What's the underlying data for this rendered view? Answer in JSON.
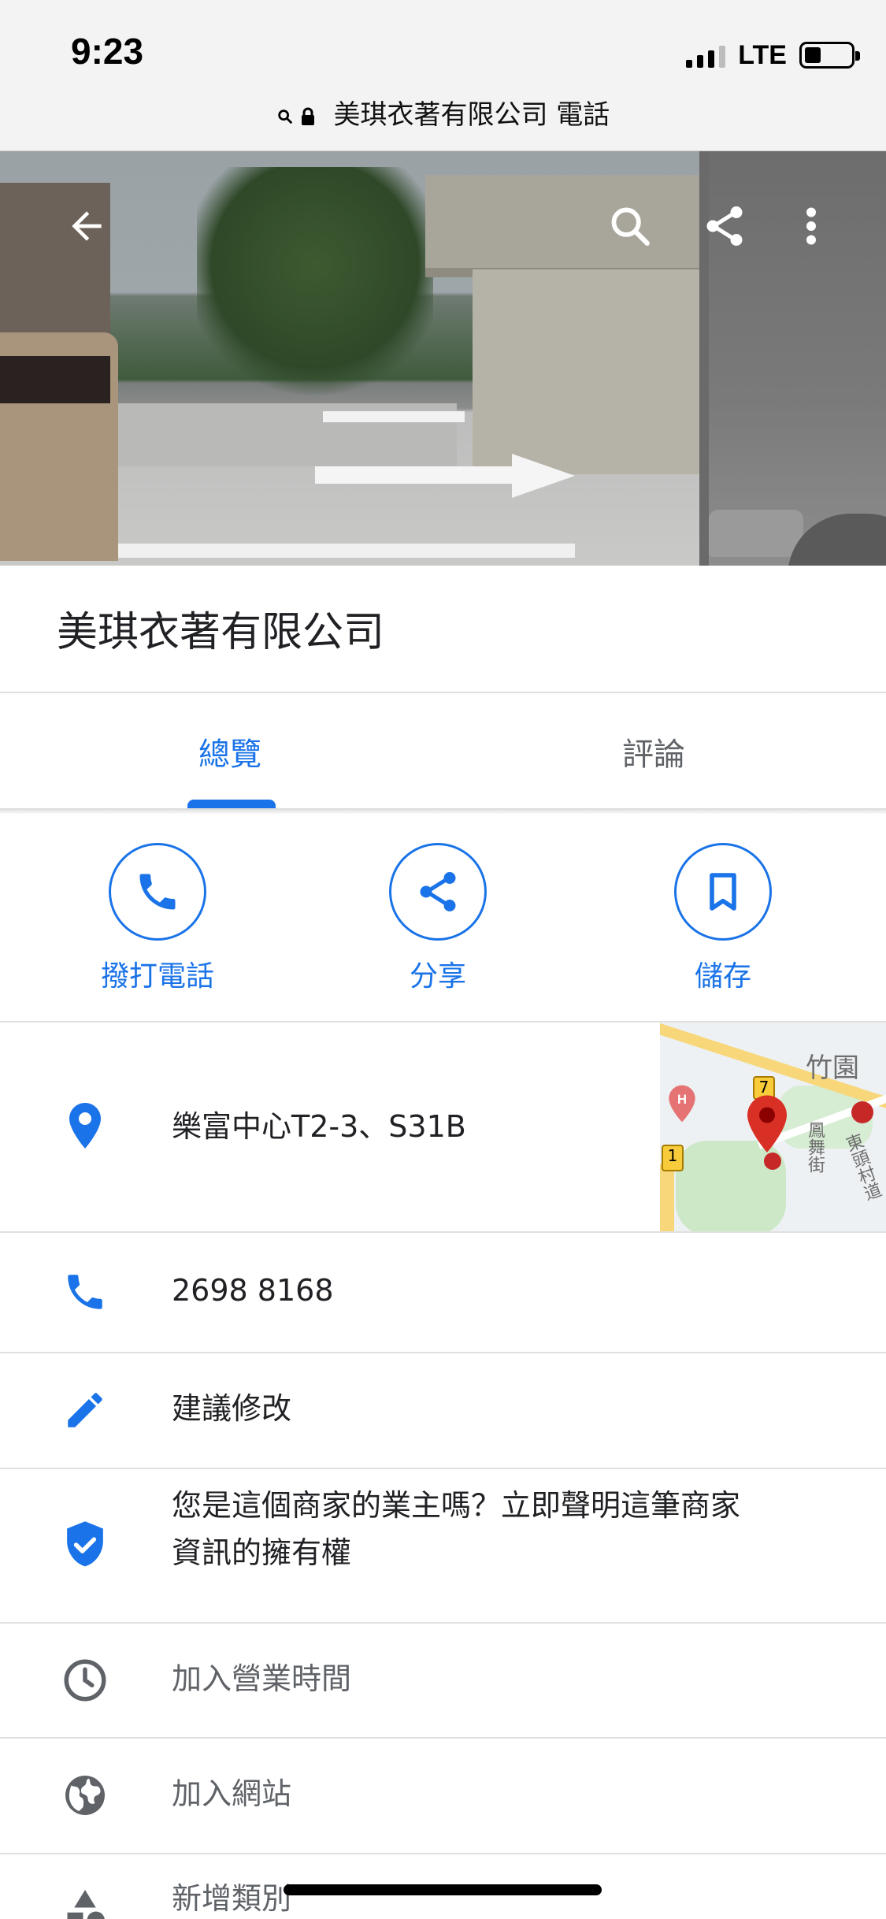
{
  "status_bar": {
    "time": "9:23",
    "network": "LTE"
  },
  "address_bar": {
    "text": "美琪衣著有限公司 電話"
  },
  "place": {
    "name": "美琪衣著有限公司"
  },
  "tabs": [
    {
      "label": "總覽",
      "active": true
    },
    {
      "label": "評論",
      "active": false
    }
  ],
  "actions": {
    "call_label": "撥打電話",
    "share_label": "分享",
    "save_label": "儲存"
  },
  "details": {
    "address": "樂富中心T2-3、S31B",
    "phone": "2698 8168",
    "suggest_edit": "建議修改",
    "claim_line1": "您是這個商家的業主嗎？立即聲明這筆商家",
    "claim_line2": "資訊的擁有權",
    "add_hours": "加入營業時間",
    "add_website": "加入網站",
    "add_category": "新增類別"
  },
  "map_thumbnail": {
    "area_label": "竹園",
    "road_label_1": "鳳舞街",
    "road_label_2": "東頭村道",
    "route_shield_1": "1",
    "route_shield_2": "7"
  },
  "colors": {
    "accent": "#1a73e8",
    "text": "#202124",
    "muted": "#5f6368",
    "divider": "#e0e0e0"
  },
  "icons": {
    "back": "back-arrow-icon",
    "search": "search-icon",
    "share": "share-icon",
    "more": "more-vert-icon",
    "call": "phone-icon",
    "save": "bookmark-icon",
    "address": "location-pin-icon",
    "phone": "phone-icon",
    "edit": "pencil-icon",
    "claim": "verified-shield-icon",
    "hours": "clock-icon",
    "website": "globe-icon",
    "category": "category-icon"
  }
}
